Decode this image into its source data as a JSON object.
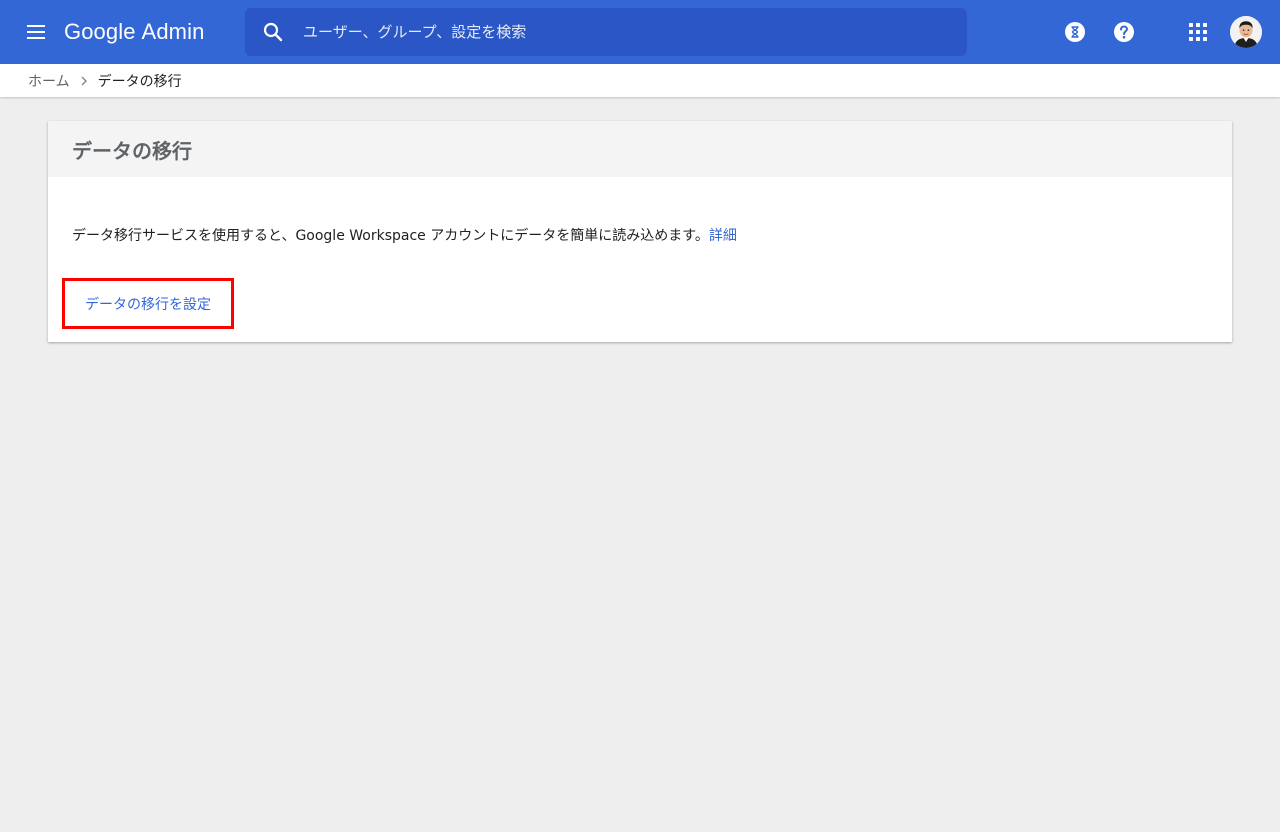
{
  "header": {
    "brand": "Google",
    "product": "Admin",
    "search_placeholder": "ユーザー、グループ、設定を検索",
    "icons": {
      "menu": "menu-icon",
      "search": "search-icon",
      "hourglass": "hourglass-icon",
      "help": "help-icon",
      "apps": "apps-grid-icon",
      "avatar": "avatar"
    },
    "colors": {
      "bar": "#3367d6",
      "search_bg": "#2a56c6"
    }
  },
  "breadcrumb": {
    "home": "ホーム",
    "current": "データの移行"
  },
  "card": {
    "title": "データの移行",
    "description": "データ移行サービスを使用すると、Google Workspace アカウントにデータを簡単に読み込めます。",
    "details_link": "詳細",
    "setup_button": "データの移行を設定",
    "highlight_color": "#ff0000",
    "link_color": "#3367d6"
  }
}
